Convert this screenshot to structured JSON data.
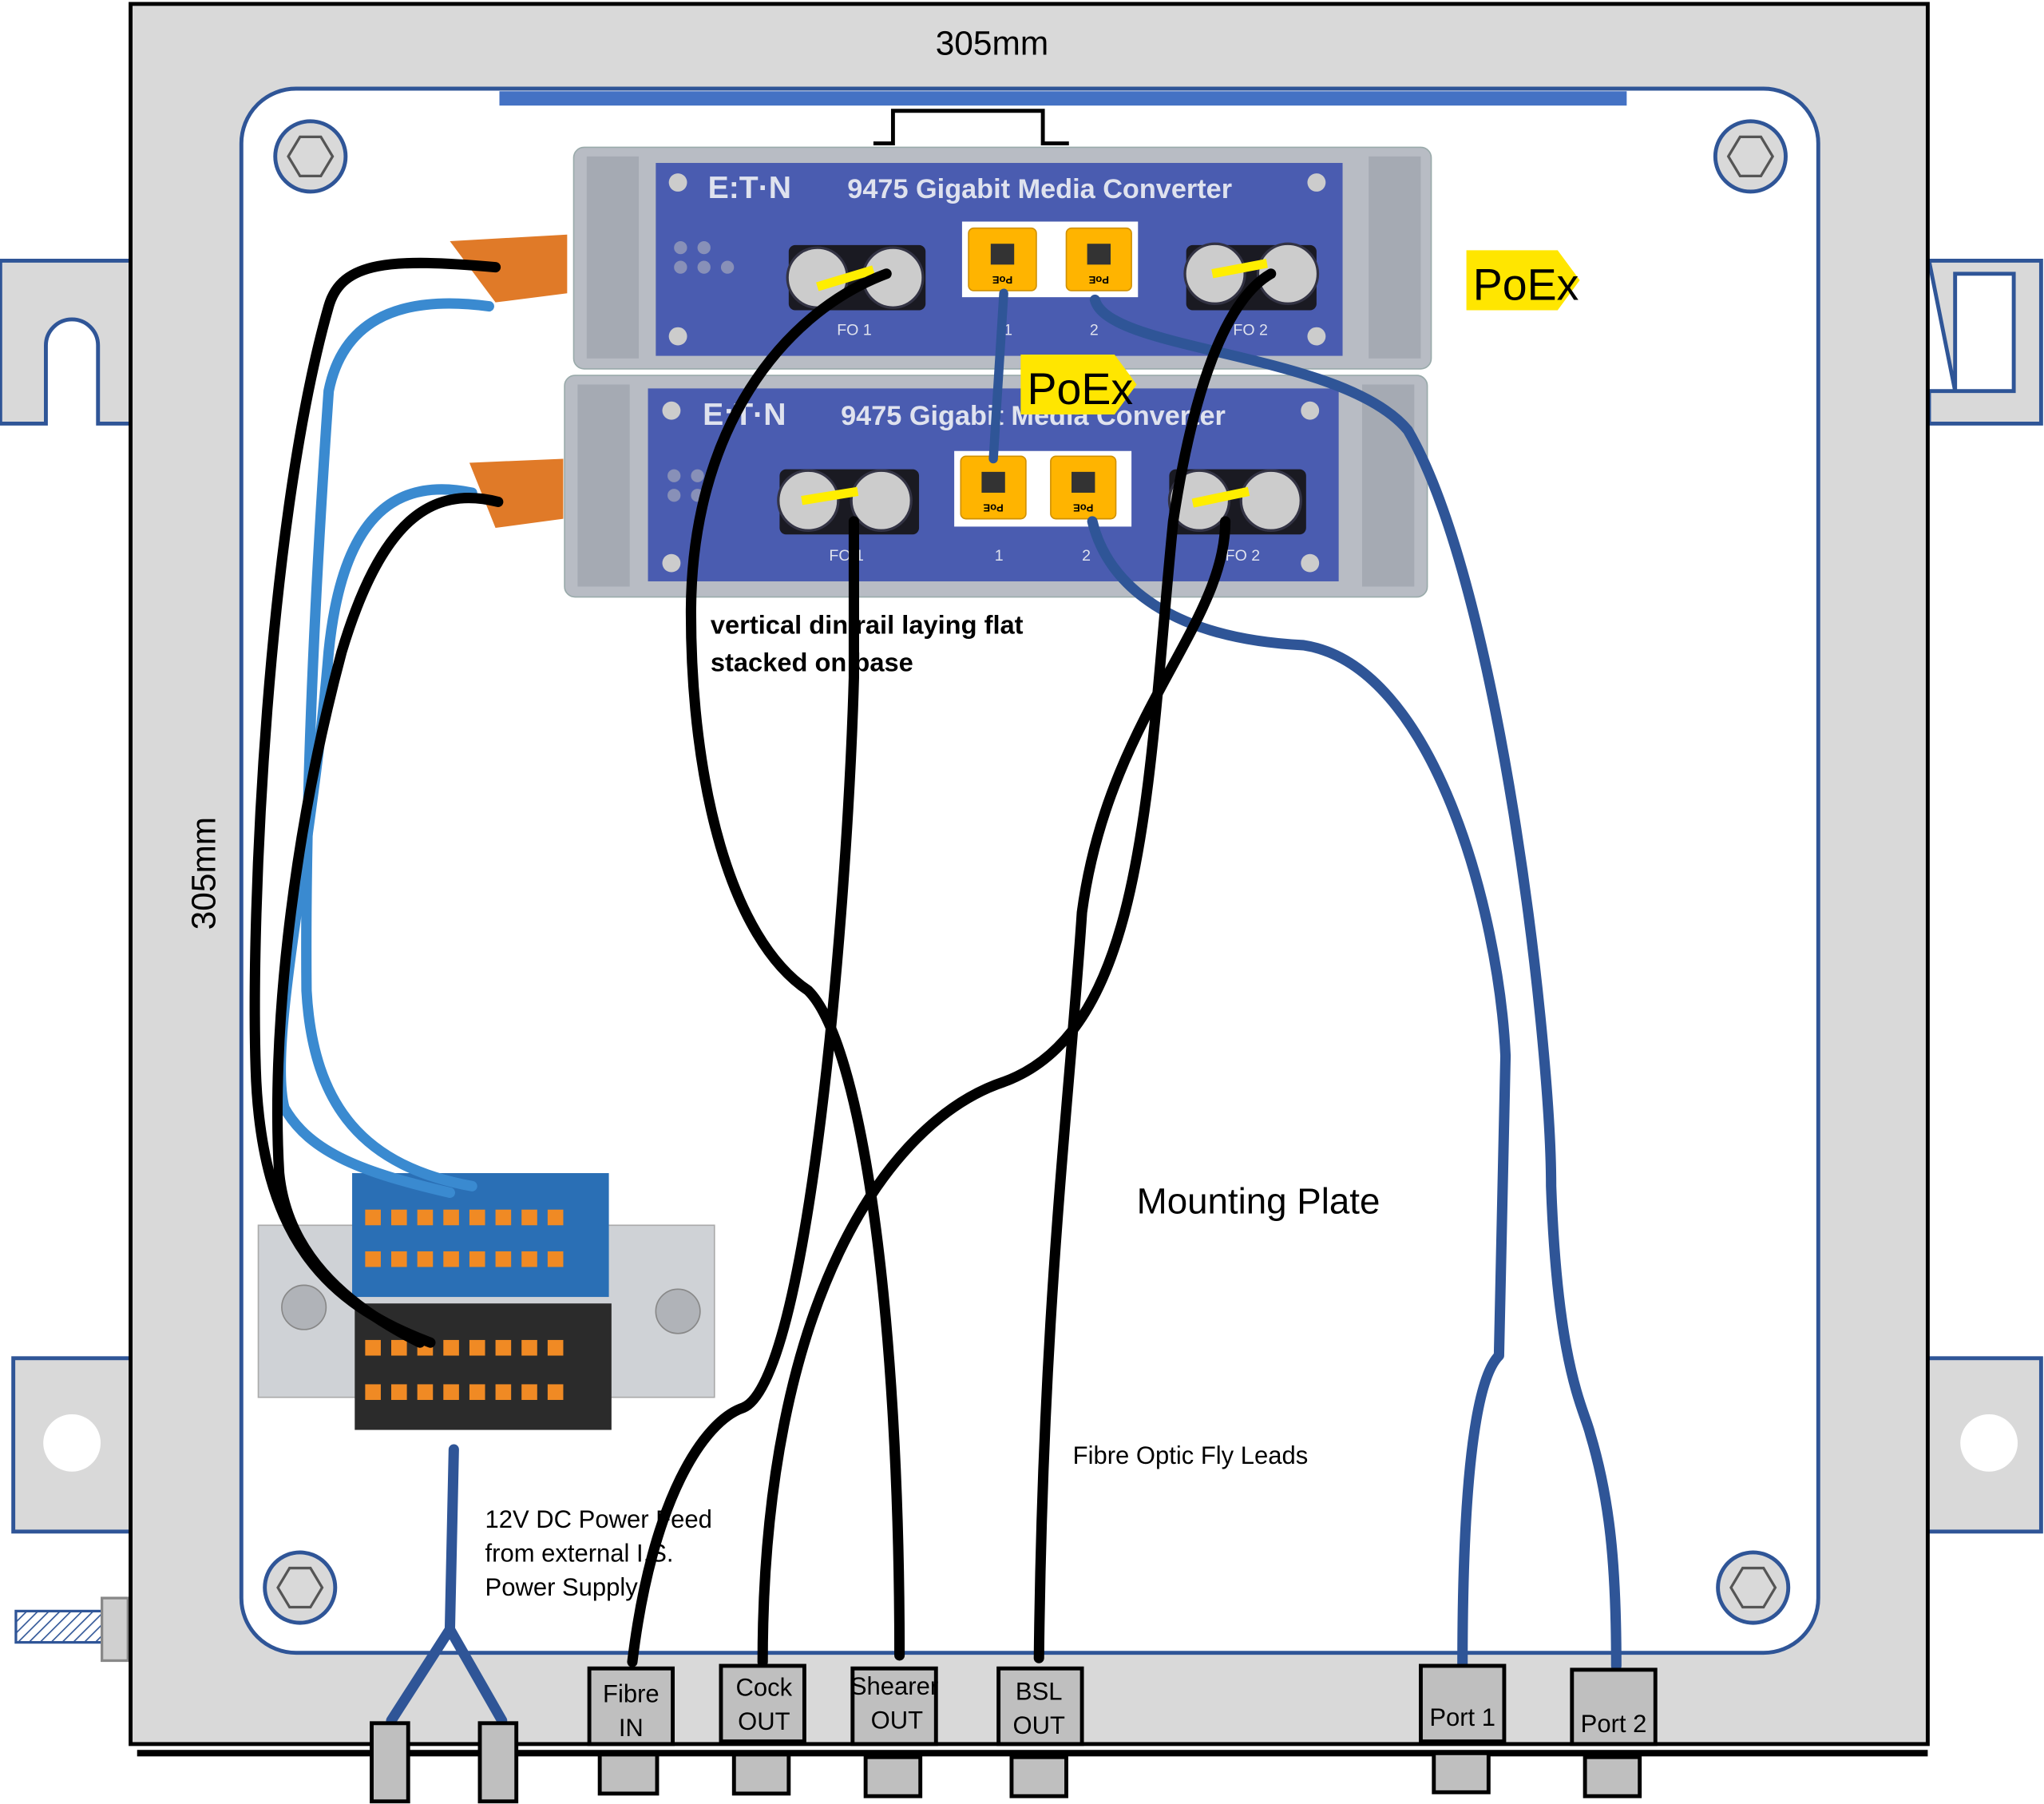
{
  "dimensions": {
    "width_label": "305mm",
    "height_label": "305mm"
  },
  "converters": [
    {
      "brand": "E:T·N",
      "title": "9475 Gigabit Media Converter",
      "fo1": "FO 1",
      "port1": "1",
      "port2": "2",
      "fo2": "FO 2",
      "poe_label": "PoE"
    },
    {
      "brand": "E:T·N",
      "title": "9475 Gigabit Media Converter",
      "fo1": "FO 1",
      "port1": "1",
      "port2": "2",
      "fo2": "FO 2",
      "poe_label": "PoE"
    }
  ],
  "logos": {
    "poex": "PoEx"
  },
  "notes": {
    "din_line1": "vertical din rail laying flat",
    "din_line2": "stacked on base",
    "mounting_plate": "Mounting Plate",
    "fly_leads": "Fibre Optic Fly Leads",
    "power_line1": "12V DC Power Feed",
    "power_line2": "from external I.S.",
    "power_line3": "Power Supply"
  },
  "glands": [
    {
      "line1": "Fibre",
      "line2": "IN"
    },
    {
      "line1": "Cock",
      "line2": "OUT"
    },
    {
      "line1": "Shearer",
      "line2": "OUT"
    },
    {
      "line1": "BSL",
      "line2": "OUT"
    },
    {
      "line1": "Port 1",
      "line2": ""
    },
    {
      "line1": "Port 2",
      "line2": ""
    }
  ],
  "colors": {
    "enclosure": "#d9d9d9",
    "plate_border": "#2f5597",
    "rail_bar": "#4472c4",
    "converter_panel": "#4a5cb0",
    "fibre_cable": "#000000",
    "ethernet_cable": "#2f5597",
    "power_blue": "#3a8ad0",
    "poe_yellow": "#ffd200"
  }
}
